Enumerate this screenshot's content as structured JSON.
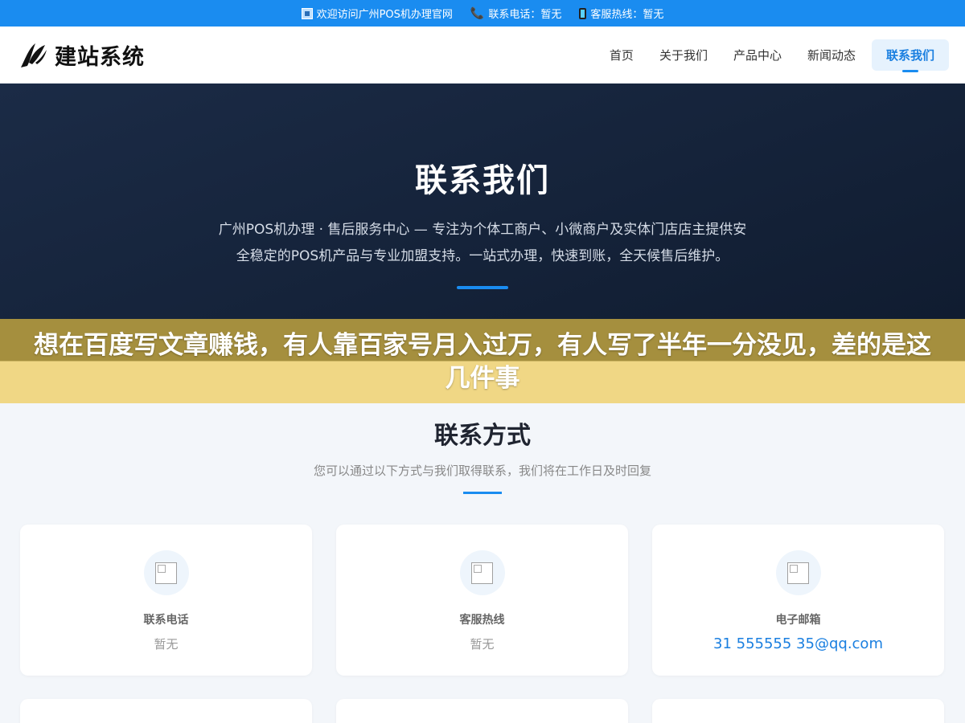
{
  "topbar": {
    "welcome": "欢迎访问广州POS机办理官网",
    "phone_label": "联系电话：暂无",
    "hotline_label": "客服热线：暂无"
  },
  "header": {
    "logo_text": "建站系统",
    "nav": [
      {
        "label": "首页"
      },
      {
        "label": "关于我们"
      },
      {
        "label": "产品中心"
      },
      {
        "label": "新闻动态"
      },
      {
        "label": "联系我们",
        "active": true
      }
    ]
  },
  "hero": {
    "title": "联系我们",
    "description": "广州POS机办理 · 售后服务中心 — 专注为个体工商户、小微商户及实体门店店主提供安全稳定的POS机产品与专业加盟支持。一站式办理，快速到账，全天候售后维护。"
  },
  "banner": {
    "text": "想在百度写文章赚钱，有人靠百家号月入过万，有人写了半年一分没见，差的是这几件事"
  },
  "contact": {
    "title": "联系方式",
    "subtitle": "您可以通过以下方式与我们取得联系，我们将在工作日及时回复",
    "cards": [
      {
        "icon": "phone-icon",
        "label": "联系电话",
        "value": "暂无"
      },
      {
        "icon": "hotline-icon",
        "label": "客服热线",
        "value": "暂无"
      },
      {
        "icon": "email-icon",
        "label": "电子邮箱",
        "value": "31 555555 35@qq.com"
      }
    ]
  },
  "colors": {
    "primary": "#1a8cf0",
    "hero_bg": "#15233a",
    "banner_top": "#a58f3e",
    "banner_bottom": "#f0d785"
  }
}
